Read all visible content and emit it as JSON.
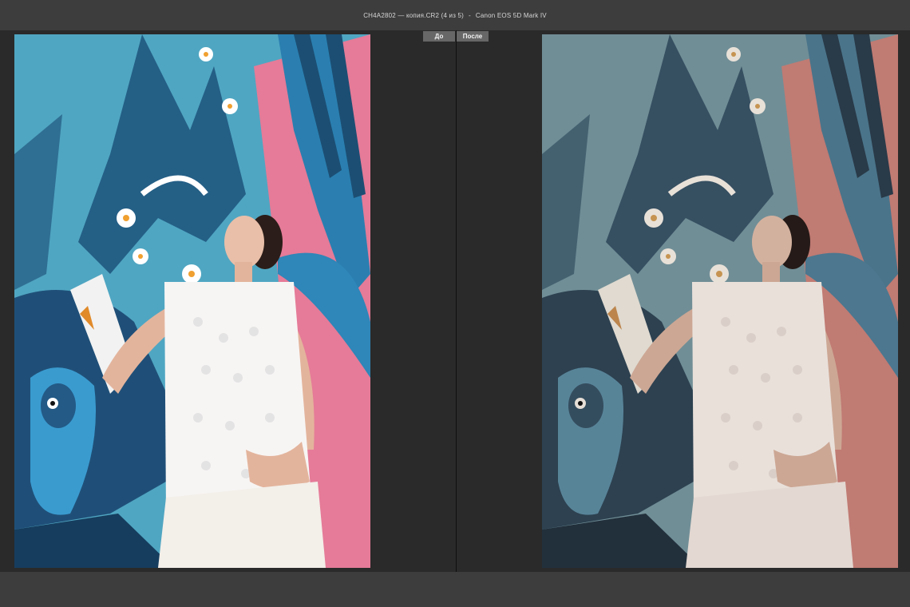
{
  "window": {
    "filename": "CH4A2802 — копия.CR2 (4 из 5)",
    "separator": "-",
    "camera": "Canon EOS 5D Mark IV"
  },
  "compare": {
    "before_label": "До",
    "after_label": "После"
  },
  "colors": {
    "chrome": "#3d3d3d",
    "workspace": "#2a2a2a",
    "tab": "#676767"
  }
}
